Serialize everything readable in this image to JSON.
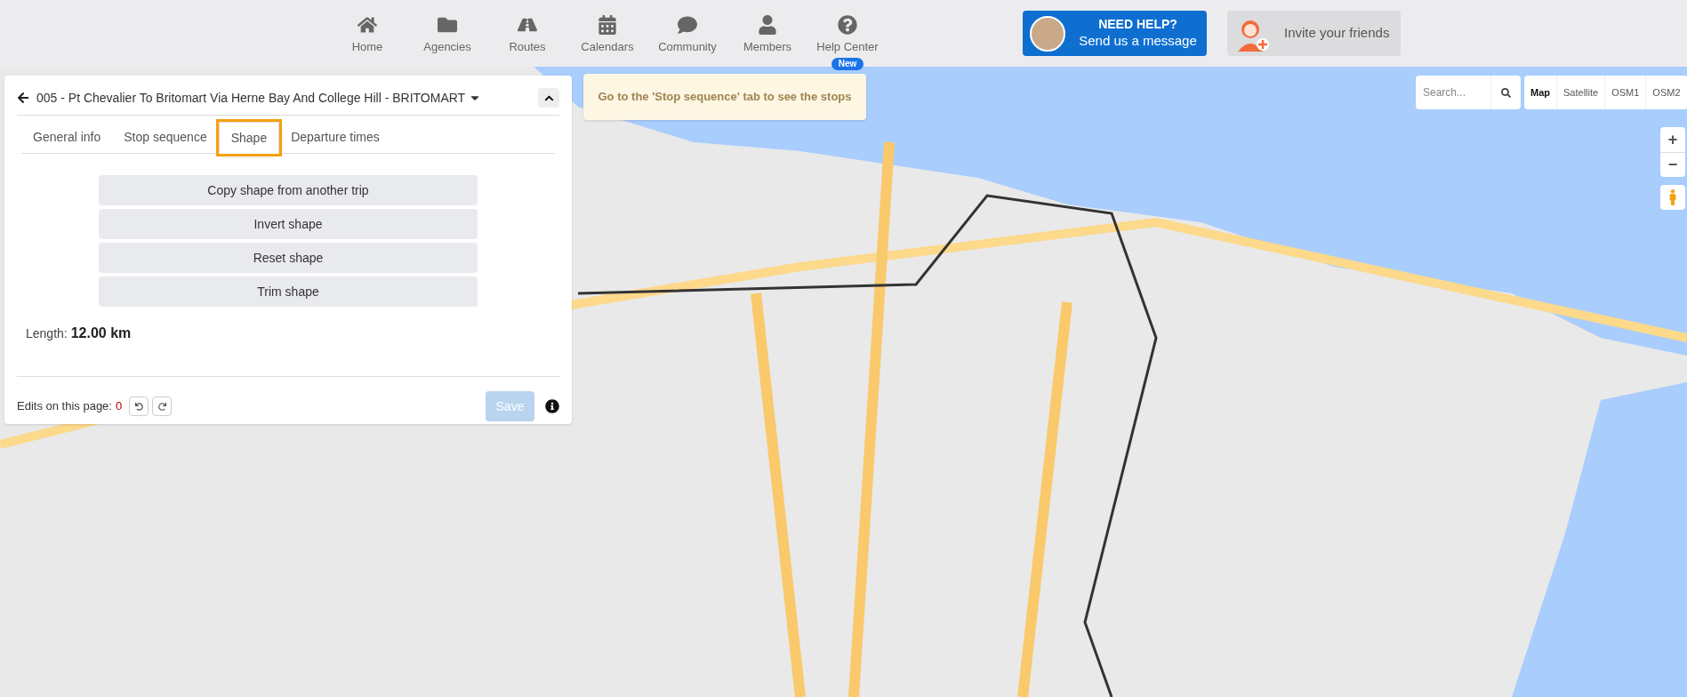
{
  "nav": [
    {
      "kind": "home",
      "label": "Home"
    },
    {
      "kind": "agencies",
      "label": "Agencies"
    },
    {
      "kind": "routes",
      "label": "Routes"
    },
    {
      "kind": "calendars",
      "label": "Calendars"
    },
    {
      "kind": "community",
      "label": "Community"
    },
    {
      "kind": "members",
      "label": "Members"
    },
    {
      "kind": "help",
      "label": "Help Center",
      "badge": "New"
    }
  ],
  "help_button": {
    "title": "NEED HELP?",
    "subtitle": "Send us a message"
  },
  "invite_button": {
    "label": "Invite your friends"
  },
  "panel": {
    "title": "005 - Pt Chevalier To Britomart Via Herne Bay And College Hill - BRITOMART",
    "tabs": [
      {
        "label": "General info",
        "selected": false,
        "highlighted": false
      },
      {
        "label": "Stop sequence",
        "selected": false,
        "highlighted": false
      },
      {
        "label": "Shape",
        "selected": true,
        "highlighted": true
      },
      {
        "label": "Departure times",
        "selected": false,
        "highlighted": false
      }
    ],
    "actions": [
      "Copy shape from another trip",
      "Invert shape",
      "Reset shape",
      "Trim shape"
    ],
    "length_label": "Length:",
    "length_value": "12.00 km",
    "edits_label": "Edits on this page:",
    "edits_count": "0",
    "save": {
      "label": "Save",
      "disabled": true
    }
  },
  "hint": "Go to the 'Stop sequence' tab to see the stops",
  "map_search": {
    "placeholder": "Search..."
  },
  "map_types": [
    {
      "label": "Map",
      "selected": true
    },
    {
      "label": "Satellite",
      "selected": false
    },
    {
      "label": "OSM1",
      "selected": false
    },
    {
      "label": "OSM2",
      "selected": false
    }
  ],
  "zoom": {
    "in": "+",
    "out": "−"
  }
}
